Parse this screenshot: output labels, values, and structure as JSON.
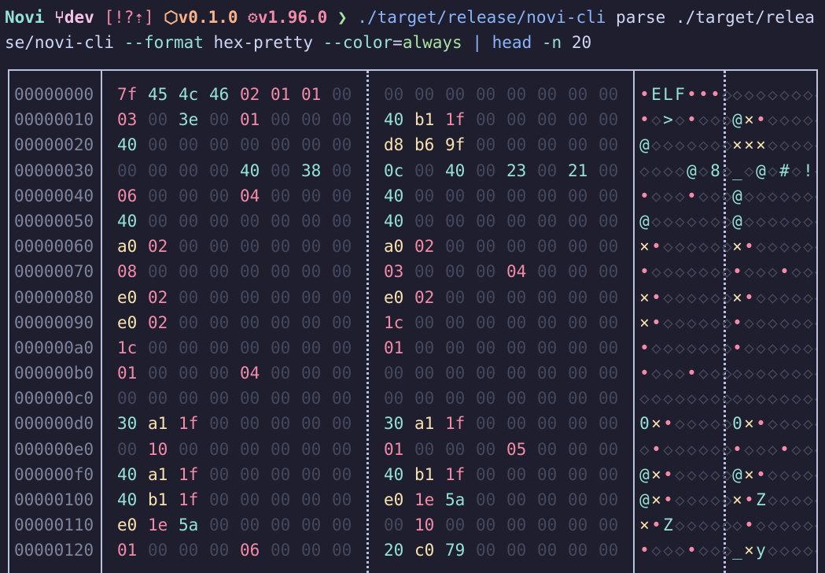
{
  "prompt": {
    "dir": "Novi",
    "branch_icon": "git-branch-icon",
    "branch": "dev",
    "status": "[!?⇡]",
    "package_icon": "package-icon",
    "package_version": "v0.1.0",
    "rust_icon": "rust-icon",
    "rust_version": "v1.96.0",
    "arrow": "❯"
  },
  "command": {
    "program": "./target/release/novi-cli",
    "subcommand": "parse",
    "arg": "./target/release/novi-cli",
    "flag_format": "--format",
    "format_value": "hex-pretty",
    "flag_color": "--color",
    "equals": "=",
    "color_value": "always",
    "pipe": "|",
    "pipe_cmd": "head",
    "pipe_flag": "-n",
    "pipe_arg": "20"
  },
  "dump": {
    "rows": [
      {
        "offset": "00000000",
        "bytes": [
          "7f",
          "45",
          "4c",
          "46",
          "02",
          "01",
          "01",
          "00",
          "00",
          "00",
          "00",
          "00",
          "00",
          "00",
          "00",
          "00"
        ],
        "ascii": [
          "•",
          "E",
          "L",
          "F",
          "•",
          "•",
          "•",
          "◇",
          "◇",
          "◇",
          "◇",
          "◇",
          "◇",
          "◇",
          "◇",
          "◇"
        ]
      },
      {
        "offset": "00000010",
        "bytes": [
          "03",
          "00",
          "3e",
          "00",
          "01",
          "00",
          "00",
          "00",
          "40",
          "b1",
          "1f",
          "00",
          "00",
          "00",
          "00",
          "00"
        ],
        "ascii": [
          "•",
          "◇",
          ">",
          "◇",
          "•",
          "◇",
          "◇",
          "◇",
          "@",
          "×",
          "•",
          "◇",
          "◇",
          "◇",
          "◇",
          "◇"
        ]
      },
      {
        "offset": "00000020",
        "bytes": [
          "40",
          "00",
          "00",
          "00",
          "00",
          "00",
          "00",
          "00",
          "d8",
          "b6",
          "9f",
          "00",
          "00",
          "00",
          "00",
          "00"
        ],
        "ascii": [
          "@",
          "◇",
          "◇",
          "◇",
          "◇",
          "◇",
          "◇",
          "◇",
          "×",
          "×",
          "×",
          "◇",
          "◇",
          "◇",
          "◇",
          "◇"
        ]
      },
      {
        "offset": "00000030",
        "bytes": [
          "00",
          "00",
          "00",
          "00",
          "40",
          "00",
          "38",
          "00",
          "0c",
          "00",
          "40",
          "00",
          "23",
          "00",
          "21",
          "00"
        ],
        "ascii": [
          "◇",
          "◇",
          "◇",
          "◇",
          "@",
          "◇",
          "8",
          "◇",
          "_",
          "◇",
          "@",
          "◇",
          "#",
          "◇",
          "!",
          "◇"
        ]
      },
      {
        "offset": "00000040",
        "bytes": [
          "06",
          "00",
          "00",
          "00",
          "04",
          "00",
          "00",
          "00",
          "40",
          "00",
          "00",
          "00",
          "00",
          "00",
          "00",
          "00"
        ],
        "ascii": [
          "•",
          "◇",
          "◇",
          "◇",
          "•",
          "◇",
          "◇",
          "◇",
          "@",
          "◇",
          "◇",
          "◇",
          "◇",
          "◇",
          "◇",
          "◇"
        ]
      },
      {
        "offset": "00000050",
        "bytes": [
          "40",
          "00",
          "00",
          "00",
          "00",
          "00",
          "00",
          "00",
          "40",
          "00",
          "00",
          "00",
          "00",
          "00",
          "00",
          "00"
        ],
        "ascii": [
          "@",
          "◇",
          "◇",
          "◇",
          "◇",
          "◇",
          "◇",
          "◇",
          "@",
          "◇",
          "◇",
          "◇",
          "◇",
          "◇",
          "◇",
          "◇"
        ]
      },
      {
        "offset": "00000060",
        "bytes": [
          "a0",
          "02",
          "00",
          "00",
          "00",
          "00",
          "00",
          "00",
          "a0",
          "02",
          "00",
          "00",
          "00",
          "00",
          "00",
          "00"
        ],
        "ascii": [
          "×",
          "•",
          "◇",
          "◇",
          "◇",
          "◇",
          "◇",
          "◇",
          "×",
          "•",
          "◇",
          "◇",
          "◇",
          "◇",
          "◇",
          "◇"
        ]
      },
      {
        "offset": "00000070",
        "bytes": [
          "08",
          "00",
          "00",
          "00",
          "00",
          "00",
          "00",
          "00",
          "03",
          "00",
          "00",
          "00",
          "04",
          "00",
          "00",
          "00"
        ],
        "ascii": [
          "•",
          "◇",
          "◇",
          "◇",
          "◇",
          "◇",
          "◇",
          "◇",
          "•",
          "◇",
          "◇",
          "◇",
          "•",
          "◇",
          "◇",
          "◇"
        ]
      },
      {
        "offset": "00000080",
        "bytes": [
          "e0",
          "02",
          "00",
          "00",
          "00",
          "00",
          "00",
          "00",
          "e0",
          "02",
          "00",
          "00",
          "00",
          "00",
          "00",
          "00"
        ],
        "ascii": [
          "×",
          "•",
          "◇",
          "◇",
          "◇",
          "◇",
          "◇",
          "◇",
          "×",
          "•",
          "◇",
          "◇",
          "◇",
          "◇",
          "◇",
          "◇"
        ]
      },
      {
        "offset": "00000090",
        "bytes": [
          "e0",
          "02",
          "00",
          "00",
          "00",
          "00",
          "00",
          "00",
          "1c",
          "00",
          "00",
          "00",
          "00",
          "00",
          "00",
          "00"
        ],
        "ascii": [
          "×",
          "•",
          "◇",
          "◇",
          "◇",
          "◇",
          "◇",
          "◇",
          "•",
          "◇",
          "◇",
          "◇",
          "◇",
          "◇",
          "◇",
          "◇"
        ]
      },
      {
        "offset": "000000a0",
        "bytes": [
          "1c",
          "00",
          "00",
          "00",
          "00",
          "00",
          "00",
          "00",
          "01",
          "00",
          "00",
          "00",
          "00",
          "00",
          "00",
          "00"
        ],
        "ascii": [
          "•",
          "◇",
          "◇",
          "◇",
          "◇",
          "◇",
          "◇",
          "◇",
          "•",
          "◇",
          "◇",
          "◇",
          "◇",
          "◇",
          "◇",
          "◇"
        ]
      },
      {
        "offset": "000000b0",
        "bytes": [
          "01",
          "00",
          "00",
          "00",
          "04",
          "00",
          "00",
          "00",
          "00",
          "00",
          "00",
          "00",
          "00",
          "00",
          "00",
          "00"
        ],
        "ascii": [
          "•",
          "◇",
          "◇",
          "◇",
          "•",
          "◇",
          "◇",
          "◇",
          "◇",
          "◇",
          "◇",
          "◇",
          "◇",
          "◇",
          "◇",
          "◇"
        ]
      },
      {
        "offset": "000000c0",
        "bytes": [
          "00",
          "00",
          "00",
          "00",
          "00",
          "00",
          "00",
          "00",
          "00",
          "00",
          "00",
          "00",
          "00",
          "00",
          "00",
          "00"
        ],
        "ascii": [
          "◇",
          "◇",
          "◇",
          "◇",
          "◇",
          "◇",
          "◇",
          "◇",
          "◇",
          "◇",
          "◇",
          "◇",
          "◇",
          "◇",
          "◇",
          "◇"
        ]
      },
      {
        "offset": "000000d0",
        "bytes": [
          "30",
          "a1",
          "1f",
          "00",
          "00",
          "00",
          "00",
          "00",
          "30",
          "a1",
          "1f",
          "00",
          "00",
          "00",
          "00",
          "00"
        ],
        "ascii": [
          "0",
          "×",
          "•",
          "◇",
          "◇",
          "◇",
          "◇",
          "◇",
          "0",
          "×",
          "•",
          "◇",
          "◇",
          "◇",
          "◇",
          "◇"
        ]
      },
      {
        "offset": "000000e0",
        "bytes": [
          "00",
          "10",
          "00",
          "00",
          "00",
          "00",
          "00",
          "00",
          "01",
          "00",
          "00",
          "00",
          "05",
          "00",
          "00",
          "00"
        ],
        "ascii": [
          "◇",
          "•",
          "◇",
          "◇",
          "◇",
          "◇",
          "◇",
          "◇",
          "•",
          "◇",
          "◇",
          "◇",
          "•",
          "◇",
          "◇",
          "◇"
        ]
      },
      {
        "offset": "000000f0",
        "bytes": [
          "40",
          "a1",
          "1f",
          "00",
          "00",
          "00",
          "00",
          "00",
          "40",
          "b1",
          "1f",
          "00",
          "00",
          "00",
          "00",
          "00"
        ],
        "ascii": [
          "@",
          "×",
          "•",
          "◇",
          "◇",
          "◇",
          "◇",
          "◇",
          "@",
          "×",
          "•",
          "◇",
          "◇",
          "◇",
          "◇",
          "◇"
        ]
      },
      {
        "offset": "00000100",
        "bytes": [
          "40",
          "b1",
          "1f",
          "00",
          "00",
          "00",
          "00",
          "00",
          "e0",
          "1e",
          "5a",
          "00",
          "00",
          "00",
          "00",
          "00"
        ],
        "ascii": [
          "@",
          "×",
          "•",
          "◇",
          "◇",
          "◇",
          "◇",
          "◇",
          "×",
          "•",
          "Z",
          "◇",
          "◇",
          "◇",
          "◇",
          "◇"
        ]
      },
      {
        "offset": "00000110",
        "bytes": [
          "e0",
          "1e",
          "5a",
          "00",
          "00",
          "00",
          "00",
          "00",
          "00",
          "10",
          "00",
          "00",
          "00",
          "00",
          "00",
          "00"
        ],
        "ascii": [
          "×",
          "•",
          "Z",
          "◇",
          "◇",
          "◇",
          "◇",
          "◇",
          "◇",
          "•",
          "◇",
          "◇",
          "◇",
          "◇",
          "◇",
          "◇"
        ]
      },
      {
        "offset": "00000120",
        "bytes": [
          "01",
          "00",
          "00",
          "00",
          "06",
          "00",
          "00",
          "00",
          "20",
          "c0",
          "79",
          "00",
          "00",
          "00",
          "00",
          "00"
        ],
        "ascii": [
          "•",
          "◇",
          "◇",
          "◇",
          "•",
          "◇",
          "◇",
          "◇",
          "_",
          "×",
          "y",
          "◇",
          "◇",
          "◇",
          "◇",
          "◇"
        ]
      }
    ]
  },
  "colors": {
    "background": "#1e1e2e",
    "null_byte": "#45475a",
    "printable": "#94e2d5",
    "control": "#f38ba8",
    "high": "#f9e2af",
    "offset": "#7f849c",
    "border": "#bac2de"
  }
}
